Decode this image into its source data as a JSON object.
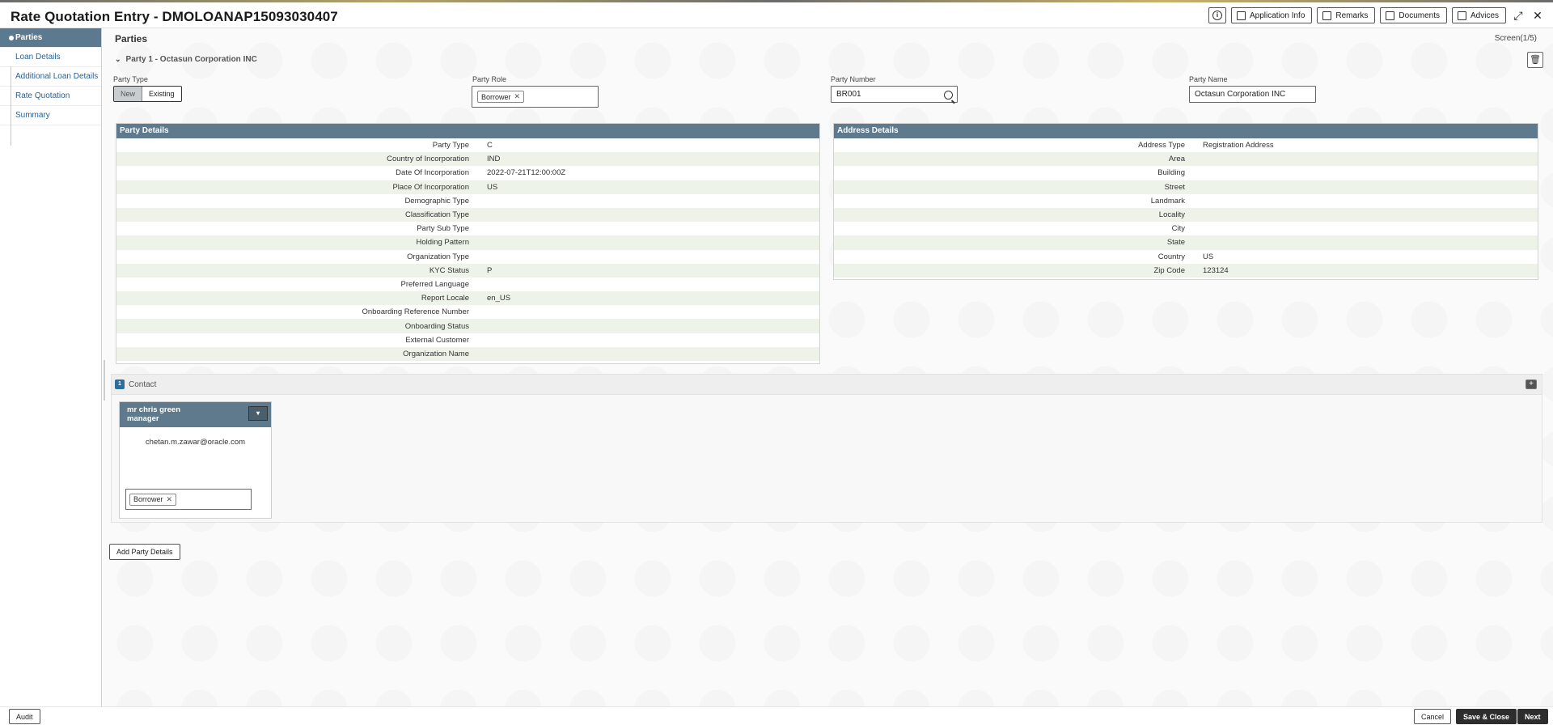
{
  "header": {
    "title": "Rate Quotation Entry - DMOLOANAP15093030407",
    "actions": {
      "application_info": "Application Info",
      "remarks": "Remarks",
      "documents": "Documents",
      "advices": "Advices"
    }
  },
  "sidebar": {
    "items": [
      {
        "label": "Parties",
        "active": true
      },
      {
        "label": "Loan Details"
      },
      {
        "label": "Additional Loan Details"
      },
      {
        "label": "Rate Quotation"
      },
      {
        "label": "Summary"
      }
    ]
  },
  "main": {
    "section_title": "Parties",
    "screen_indicator": "Screen(1/5)",
    "party_heading": "Party 1 -  Octasun Corporation INC",
    "party_type_label": "Party Type",
    "party_type_options": {
      "new": "New",
      "existing": "Existing"
    },
    "party_role_label": "Party Role",
    "party_role_tag": "Borrower",
    "party_number_label": "Party Number",
    "party_number_value": "BR001",
    "party_name_label": "Party Name",
    "party_name_value": "Octasun Corporation INC"
  },
  "party_details": {
    "title": "Party Details",
    "rows": [
      {
        "k": "Party Type",
        "v": "C"
      },
      {
        "k": "Country of Incorporation",
        "v": "IND"
      },
      {
        "k": "Date Of Incorporation",
        "v": "2022-07-21T12:00:00Z"
      },
      {
        "k": "Place Of Incorporation",
        "v": "US"
      },
      {
        "k": "Demographic Type",
        "v": ""
      },
      {
        "k": "Classification Type",
        "v": ""
      },
      {
        "k": "Party Sub Type",
        "v": ""
      },
      {
        "k": "Holding Pattern",
        "v": ""
      },
      {
        "k": "Organization Type",
        "v": ""
      },
      {
        "k": "KYC Status",
        "v": "P"
      },
      {
        "k": "Preferred Language",
        "v": ""
      },
      {
        "k": "Report Locale",
        "v": "en_US"
      },
      {
        "k": "Onboarding Reference Number",
        "v": ""
      },
      {
        "k": "Onboarding Status",
        "v": ""
      },
      {
        "k": "External Customer",
        "v": ""
      },
      {
        "k": "Organization Name",
        "v": ""
      }
    ]
  },
  "address_details": {
    "title": "Address Details",
    "rows": [
      {
        "k": "Address Type",
        "v": "Registration Address"
      },
      {
        "k": "Area",
        "v": ""
      },
      {
        "k": "Building",
        "v": ""
      },
      {
        "k": "Street",
        "v": ""
      },
      {
        "k": "Landmark",
        "v": ""
      },
      {
        "k": "Locality",
        "v": ""
      },
      {
        "k": "City",
        "v": ""
      },
      {
        "k": "State",
        "v": ""
      },
      {
        "k": "Country",
        "v": "US"
      },
      {
        "k": "Zip Code",
        "v": "123124"
      }
    ]
  },
  "contact": {
    "count": "1",
    "label": "Contact",
    "card": {
      "name": "mr  chris  green",
      "designation": "manager",
      "email": "chetan.m.zawar@oracle.com",
      "role_tag": "Borrower"
    }
  },
  "add_party_label": "Add Party Details",
  "footer": {
    "audit": "Audit",
    "cancel": "Cancel",
    "save_close": "Save & Close",
    "next": "Next"
  }
}
